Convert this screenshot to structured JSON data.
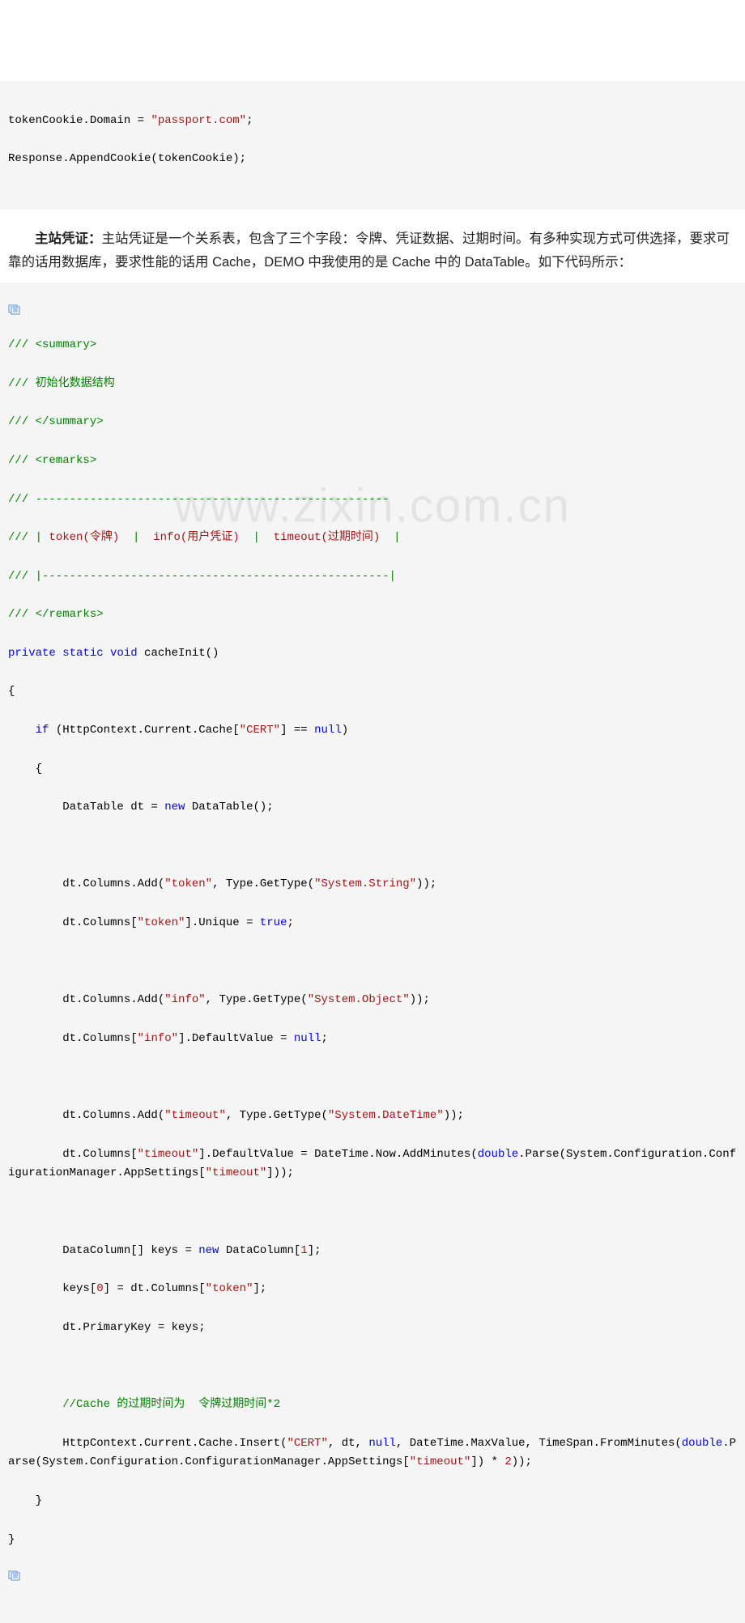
{
  "top_code": {
    "line1_a": "tokenCookie.Domain = ",
    "line1_b": "\"passport.com\"",
    "line1_c": ";",
    "line2": "Response.AppendCookie(tokenCookie);"
  },
  "paragraph": {
    "heading": "主站凭证：",
    "body": "主站凭证是一个关系表，包含了三个字段：令牌、凭证数据、过期时间。有多种实现方式可供选择，要求可靠的话用数据库，要求性能的话用 Cache，DEMO 中我使用的是 Cache 中的 DataTable。如下代码所示："
  },
  "code": {
    "c01": "/// <summary>",
    "c02": "/// 初始化数据结构",
    "c03": "/// </summary>",
    "c04": "/// <remarks>",
    "c05": "/// ----------------------------------------------------",
    "c06a": "/// | ",
    "c06b": "token(令牌)",
    "c06c": "  |  ",
    "c06d": "info(用户凭证)",
    "c06e": "  |  ",
    "c06f": "timeout(过期时间)",
    "c06g": "  |",
    "c07": "/// |---------------------------------------------------|",
    "c08": "/// </remarks>",
    "c09a": "private",
    "c09b": " static",
    "c09c": " void",
    "c09d": " cacheInit()",
    "c10": "{",
    "c11a": "    if",
    "c11b": " (HttpContext.Current.Cache[",
    "c11c": "\"CERT\"",
    "c11d": "] == ",
    "c11e": "null",
    "c11f": ")",
    "c12": "    {",
    "c13a": "        DataTable dt = ",
    "c13b": "new",
    "c13c": " DataTable();",
    "c14": " ",
    "c15a": "        dt.Columns.Add(",
    "c15b": "\"token\"",
    "c15c": ", Type.GetType(",
    "c15d": "\"System.String\"",
    "c15e": "));",
    "c16a": "        dt.Columns[",
    "c16b": "\"token\"",
    "c16c": "].Unique = ",
    "c16d": "true",
    "c16e": ";",
    "c17": " ",
    "c18a": "        dt.Columns.Add(",
    "c18b": "\"info\"",
    "c18c": ", Type.GetType(",
    "c18d": "\"System.Object\"",
    "c18e": "));",
    "c19a": "        dt.Columns[",
    "c19b": "\"info\"",
    "c19c": "].DefaultValue = ",
    "c19d": "null",
    "c19e": ";",
    "c20": " ",
    "c21a": "        dt.Columns.Add(",
    "c21b": "\"timeout\"",
    "c21c": ", Type.GetType(",
    "c21d": "\"System.DateTime\"",
    "c21e": "));",
    "c22a": "        dt.Columns[",
    "c22b": "\"timeout\"",
    "c22c": "].DefaultValue = DateTime.Now.AddMinutes(",
    "c22d": "double",
    "c22e": ".Parse(System.Configuration.ConfigurationManager.AppSettings[",
    "c22f": "\"timeout\"",
    "c22g": "]));",
    "c23": " ",
    "c24a": "        DataColumn[] keys = ",
    "c24b": "new",
    "c24c": " DataColumn[",
    "c24d": "1",
    "c24e": "];",
    "c25a": "        keys[",
    "c25b": "0",
    "c25c": "] = dt.Columns[",
    "c25d": "\"token\"",
    "c25e": "];",
    "c26": "        dt.PrimaryKey = keys;",
    "c27": " ",
    "c28": "        //Cache 的过期时间为  令牌过期时间*2",
    "c29a": "        HttpContext.Current.Cache.Insert(",
    "c29b": "\"CERT\"",
    "c29c": ", dt, ",
    "c29d": "null",
    "c29e": ", DateTime.MaxValue, TimeSpan.FromMinutes(",
    "c29f": "double",
    "c29g": ".Parse(System.Configuration.ConfigurationManager.AppSettings[",
    "c29h": "\"timeout\"",
    "c29i": "]) * ",
    "c29j": "2",
    "c29k": "));",
    "c30": "    }",
    "c31": "}"
  },
  "watermark": "www.zixin.com.cn"
}
